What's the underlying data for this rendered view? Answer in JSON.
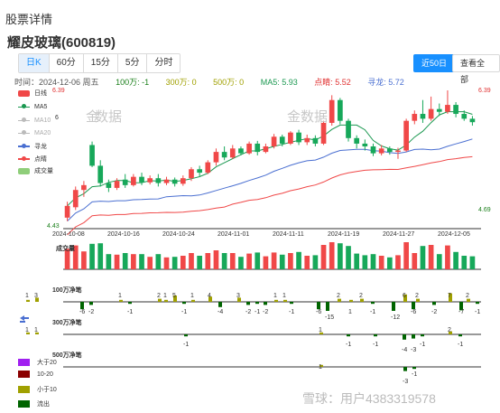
{
  "header": {
    "title": "股票详情",
    "stock": "耀皮玻璃(600819)"
  },
  "periods": [
    {
      "label": "日K",
      "active": true
    },
    {
      "label": "60分",
      "active": false
    },
    {
      "label": "15分",
      "active": false
    },
    {
      "label": "5分",
      "active": false
    },
    {
      "label": "分时",
      "active": false
    }
  ],
  "range_buttons": {
    "recent": "近50日",
    "all": "查看全部"
  },
  "info": {
    "time": "时间：2024-12-06 周五",
    "v100": "100万: -1",
    "v300": "300万: 0",
    "v500": "500万: 0",
    "ma5": "MA5: 5.93",
    "dianjing": "点睛: 5.52",
    "xunlong": "寻龙: 5.72"
  },
  "legend": [
    {
      "label": "日线",
      "kind": "bar",
      "color": "#f04848"
    },
    {
      "label": "MA5",
      "kind": "line",
      "color": "#1a9850"
    },
    {
      "label": "MA10",
      "kind": "line",
      "color": "#bbbbbb"
    },
    {
      "label": "MA20",
      "kind": "line",
      "color": "#bbbbbb"
    },
    {
      "label": "寻龙",
      "kind": "line",
      "color": "#4a6fd1"
    },
    {
      "label": "点睛",
      "kind": "line",
      "color": "#f04848"
    },
    {
      "label": "成交量",
      "kind": "bar",
      "color": "#8fce7a"
    }
  ],
  "chart_data": {
    "type": "candlestick",
    "y_left": {
      "min": "4.43",
      "max": "6.39"
    },
    "y_right": {
      "max": "6.39",
      "min": "4.69"
    },
    "y_mid_label": "6",
    "x_ticks": [
      "2024-10-08",
      "2024-10-16",
      "2024-10-24",
      "2024-11-01",
      "2024-11-11",
      "2024-11-19",
      "2024-11-27",
      "2024-12-05"
    ],
    "ylim": [
      4.43,
      6.39
    ],
    "candles": [
      [
        4.55,
        4.72,
        4.5,
        4.78
      ],
      [
        4.7,
        4.95,
        4.66,
        5.0
      ],
      [
        4.95,
        5.02,
        4.85,
        5.08
      ],
      [
        5.6,
        5.3,
        5.28,
        5.65
      ],
      [
        5.3,
        5.05,
        5.0,
        5.38
      ],
      [
        5.05,
        4.98,
        4.92,
        5.1
      ],
      [
        4.98,
        5.08,
        4.95,
        5.12
      ],
      [
        5.1,
        5.02,
        4.98,
        5.18
      ],
      [
        5.02,
        5.14,
        5.0,
        5.18
      ],
      [
        5.14,
        5.06,
        5.02,
        5.2
      ],
      [
        5.06,
        5.12,
        5.03,
        5.16
      ],
      [
        5.12,
        5.05,
        5.0,
        5.18
      ],
      [
        5.05,
        5.1,
        5.02,
        5.14
      ],
      [
        5.1,
        5.04,
        5.0,
        5.13
      ],
      [
        5.04,
        5.12,
        5.01,
        5.16
      ],
      [
        5.12,
        5.25,
        5.08,
        5.28
      ],
      [
        5.25,
        5.2,
        5.15,
        5.3
      ],
      [
        5.2,
        5.35,
        5.18,
        5.38
      ],
      [
        5.35,
        5.5,
        5.3,
        5.55
      ],
      [
        5.5,
        5.42,
        5.38,
        5.58
      ],
      [
        5.42,
        5.55,
        5.4,
        5.6
      ],
      [
        5.55,
        5.48,
        5.45,
        5.58
      ],
      [
        5.48,
        5.62,
        5.46,
        5.65
      ],
      [
        5.62,
        5.5,
        5.45,
        5.66
      ],
      [
        5.5,
        5.58,
        5.48,
        5.62
      ],
      [
        5.58,
        5.72,
        5.55,
        5.76
      ],
      [
        5.72,
        5.62,
        5.58,
        5.75
      ],
      [
        5.62,
        5.78,
        5.6,
        5.8
      ],
      [
        5.78,
        5.64,
        5.6,
        5.82
      ],
      [
        5.64,
        5.7,
        5.6,
        5.75
      ],
      [
        5.7,
        5.62,
        5.58,
        5.74
      ],
      [
        5.62,
        5.92,
        5.6,
        5.95
      ],
      [
        5.92,
        6.25,
        5.88,
        6.32
      ],
      [
        6.25,
        5.95,
        5.9,
        6.28
      ],
      [
        5.95,
        5.7,
        5.65,
        5.98
      ],
      [
        5.7,
        5.62,
        5.55,
        5.74
      ],
      [
        5.62,
        5.58,
        5.52,
        5.68
      ],
      [
        5.58,
        5.48,
        5.44,
        5.62
      ],
      [
        5.48,
        5.55,
        5.45,
        5.6
      ],
      [
        5.55,
        5.5,
        5.46,
        5.58
      ],
      [
        5.5,
        5.52,
        5.4,
        5.56
      ],
      [
        5.52,
        5.95,
        5.5,
        5.98
      ],
      [
        5.95,
        6.05,
        5.9,
        6.1
      ],
      [
        6.05,
        5.98,
        5.92,
        6.25
      ],
      [
        5.98,
        6.12,
        5.95,
        6.3
      ],
      [
        6.12,
        6.08,
        6.02,
        6.2
      ],
      [
        6.08,
        6.18,
        6.05,
        6.39
      ],
      [
        6.18,
        6.05,
        6.0,
        6.22
      ],
      [
        6.05,
        5.98,
        5.95,
        6.1
      ],
      [
        5.98,
        5.93,
        5.88,
        6.02
      ]
    ]
  },
  "volume_label": "成交量",
  "flow_labels": {
    "f100": "100万净笔",
    "f300": "300万净笔",
    "f500": "500万净笔"
  },
  "flow100_nums": [
    {
      "t": "1",
      "x": 28,
      "y": 324
    },
    {
      "t": "3",
      "x": 38,
      "y": 324
    },
    {
      "t": "-6",
      "x": 88,
      "y": 342
    },
    {
      "t": "-2",
      "x": 98,
      "y": 342
    },
    {
      "t": "1",
      "x": 131,
      "y": 324
    },
    {
      "t": "-1",
      "x": 141,
      "y": 342
    },
    {
      "t": "2",
      "x": 174,
      "y": 324
    },
    {
      "t": "1",
      "x": 181,
      "y": 324
    },
    {
      "t": "5",
      "x": 191,
      "y": 324
    },
    {
      "t": "1",
      "x": 211,
      "y": 324
    },
    {
      "t": "-1",
      "x": 201,
      "y": 342
    },
    {
      "t": "4",
      "x": 230,
      "y": 324
    },
    {
      "t": "-4",
      "x": 241,
      "y": 342
    },
    {
      "t": "3",
      "x": 262,
      "y": 324
    },
    {
      "t": "-2",
      "x": 272,
      "y": 342
    },
    {
      "t": "-1",
      "x": 282,
      "y": 342
    },
    {
      "t": "-2",
      "x": 291,
      "y": 342
    },
    {
      "t": "1",
      "x": 303,
      "y": 324
    },
    {
      "t": "1",
      "x": 313,
      "y": 324
    },
    {
      "t": "-1",
      "x": 320,
      "y": 342
    },
    {
      "t": "-6",
      "x": 350,
      "y": 342
    },
    {
      "t": "-15",
      "x": 360,
      "y": 348
    },
    {
      "t": "2",
      "x": 373,
      "y": 324
    },
    {
      "t": "1",
      "x": 386,
      "y": 342
    },
    {
      "t": "2",
      "x": 398,
      "y": 324
    },
    {
      "t": "-1",
      "x": 410,
      "y": 342
    },
    {
      "t": "6",
      "x": 446,
      "y": 324
    },
    {
      "t": "-12",
      "x": 433,
      "y": 348
    },
    {
      "t": "-6",
      "x": 455,
      "y": 342
    },
    {
      "t": "2",
      "x": 460,
      "y": 324
    },
    {
      "t": "-2",
      "x": 478,
      "y": 342
    },
    {
      "t": "7",
      "x": 496,
      "y": 324
    },
    {
      "t": "2",
      "x": 516,
      "y": 324
    },
    {
      "t": "-7",
      "x": 508,
      "y": 342
    },
    {
      "t": "-1",
      "x": 526,
      "y": 342
    }
  ],
  "flow300_nums": [
    {
      "t": "1",
      "x": 28,
      "y": 362
    },
    {
      "t": "1",
      "x": 38,
      "y": 362
    },
    {
      "t": "-1",
      "x": 203,
      "y": 378
    },
    {
      "t": "1",
      "x": 353,
      "y": 362
    },
    {
      "t": "-1",
      "x": 383,
      "y": 378
    },
    {
      "t": "-1",
      "x": 413,
      "y": 378
    },
    {
      "t": "-4",
      "x": 445,
      "y": 384
    },
    {
      "t": "-3",
      "x": 455,
      "y": 384
    },
    {
      "t": "-1",
      "x": 465,
      "y": 378
    },
    {
      "t": "2",
      "x": 496,
      "y": 362
    },
    {
      "t": "-1",
      "x": 507,
      "y": 378
    }
  ],
  "flow500_nums": [
    {
      "t": "1",
      "x": 353,
      "y": 403
    },
    {
      "t": "-3",
      "x": 446,
      "y": 419
    },
    {
      "t": "-1",
      "x": 456,
      "y": 411
    }
  ],
  "legend2": [
    {
      "label": "大于20",
      "color": "#a020f0"
    },
    {
      "label": "10-20",
      "color": "#8b0000"
    },
    {
      "label": "小于10",
      "color": "#a0a000"
    },
    {
      "label": "流出",
      "color": "#006400"
    }
  ],
  "watermarks": {
    "mid": "金",
    "mid2": "数据",
    "top2": "金",
    "top3": "数据",
    "bottom": "雪球：用户4383319578"
  }
}
